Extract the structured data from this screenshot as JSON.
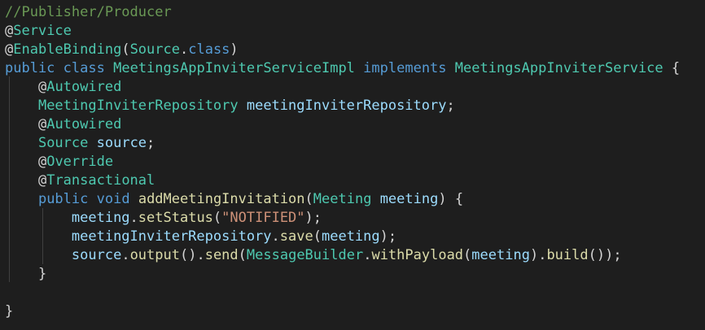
{
  "editor": {
    "lines": [
      [
        [
          "comment",
          "//Publisher/Producer"
        ]
      ],
      [
        [
          "at",
          "@"
        ],
        [
          "type",
          "Service"
        ]
      ],
      [
        [
          "at",
          "@"
        ],
        [
          "type",
          "EnableBinding"
        ],
        [
          "punc",
          "("
        ],
        [
          "type",
          "Source"
        ],
        [
          "punc",
          "."
        ],
        [
          "kw",
          "class"
        ],
        [
          "punc",
          ")"
        ]
      ],
      [
        [
          "kw",
          "public"
        ],
        [
          "punc",
          " "
        ],
        [
          "kw",
          "class"
        ],
        [
          "punc",
          " "
        ],
        [
          "type",
          "MeetingsAppInviterServiceImpl"
        ],
        [
          "punc",
          " "
        ],
        [
          "kw",
          "implements"
        ],
        [
          "punc",
          " "
        ],
        [
          "type",
          "MeetingsAppInviterService"
        ],
        [
          "punc",
          " {"
        ]
      ],
      [
        [
          "punc",
          "    "
        ],
        [
          "at",
          "@"
        ],
        [
          "type",
          "Autowired"
        ]
      ],
      [
        [
          "punc",
          "    "
        ],
        [
          "type",
          "MeetingInviterRepository"
        ],
        [
          "punc",
          " "
        ],
        [
          "var",
          "meetingInviterRepository"
        ],
        [
          "punc",
          ";"
        ]
      ],
      [
        [
          "punc",
          "    "
        ],
        [
          "at",
          "@"
        ],
        [
          "type",
          "Autowired"
        ]
      ],
      [
        [
          "punc",
          "    "
        ],
        [
          "type",
          "Source"
        ],
        [
          "punc",
          " "
        ],
        [
          "var",
          "source"
        ],
        [
          "punc",
          ";"
        ]
      ],
      [
        [
          "punc",
          "    "
        ],
        [
          "at",
          "@"
        ],
        [
          "type",
          "Override"
        ]
      ],
      [
        [
          "punc",
          "    "
        ],
        [
          "at",
          "@"
        ],
        [
          "type",
          "Transactional"
        ]
      ],
      [
        [
          "punc",
          "    "
        ],
        [
          "kw",
          "public"
        ],
        [
          "punc",
          " "
        ],
        [
          "kw",
          "void"
        ],
        [
          "punc",
          " "
        ],
        [
          "fn",
          "addMeetingInvitation"
        ],
        [
          "punc",
          "("
        ],
        [
          "type",
          "Meeting"
        ],
        [
          "punc",
          " "
        ],
        [
          "var",
          "meeting"
        ],
        [
          "punc",
          ") {"
        ]
      ],
      [
        [
          "punc",
          "        "
        ],
        [
          "var",
          "meeting"
        ],
        [
          "punc",
          "."
        ],
        [
          "fn",
          "setStatus"
        ],
        [
          "punc",
          "("
        ],
        [
          "str",
          "\"NOTIFIED\""
        ],
        [
          "punc",
          ");"
        ]
      ],
      [
        [
          "punc",
          "        "
        ],
        [
          "var",
          "meetingInviterRepository"
        ],
        [
          "punc",
          "."
        ],
        [
          "fn",
          "save"
        ],
        [
          "punc",
          "("
        ],
        [
          "var",
          "meeting"
        ],
        [
          "punc",
          ");"
        ]
      ],
      [
        [
          "punc",
          "        "
        ],
        [
          "var",
          "source"
        ],
        [
          "punc",
          "."
        ],
        [
          "fn",
          "output"
        ],
        [
          "punc",
          "()."
        ],
        [
          "fn",
          "send"
        ],
        [
          "punc",
          "("
        ],
        [
          "type",
          "MessageBuilder"
        ],
        [
          "punc",
          "."
        ],
        [
          "fn",
          "withPayload"
        ],
        [
          "punc",
          "("
        ],
        [
          "var",
          "meeting"
        ],
        [
          "punc",
          ")."
        ],
        [
          "fn",
          "build"
        ],
        [
          "punc",
          "());"
        ]
      ],
      [
        [
          "punc",
          "    }"
        ]
      ],
      [
        [
          "punc",
          ""
        ]
      ],
      [
        [
          "punc",
          "}"
        ]
      ]
    ]
  }
}
